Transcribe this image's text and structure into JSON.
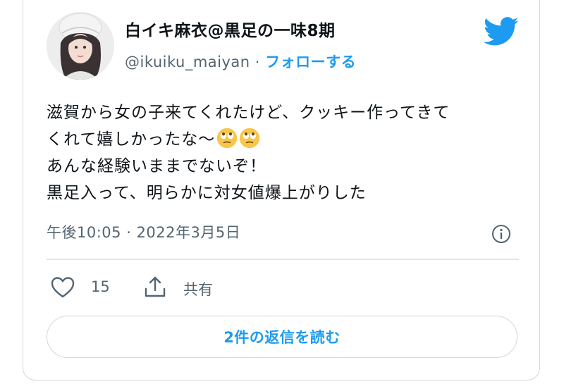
{
  "user": {
    "display_name": "白イキ麻衣@黒足の一味8期",
    "handle": "@ikuiku_maiyan",
    "separator": " · ",
    "follow_label": "フォローする"
  },
  "tweet": {
    "line1": "滋賀から女の子来てくれたけど、クッキー作ってきて",
    "line2": "くれて嬉しかったな〜",
    "line3": "あんな経験いままでないぞ！",
    "line4": "黒足入って、明らかに対女値爆上がりした",
    "emojis": [
      "face-with-rolling-eyes",
      "face-with-rolling-eyes"
    ]
  },
  "timestamp": "午後10:05 · 2022年3月5日",
  "actions": {
    "like_count": "15",
    "share_label": "共有"
  },
  "replies_button": "2件の返信を読む",
  "colors": {
    "accent": "#1d9bf0",
    "secondary_text": "#536471",
    "border": "#cfd9de",
    "emoji": "#f7c64a"
  },
  "icons": [
    "twitter-bird-icon",
    "info-icon",
    "heart-icon",
    "share-icon"
  ]
}
